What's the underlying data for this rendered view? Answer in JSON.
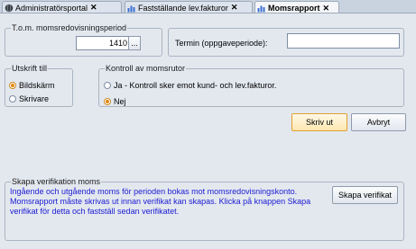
{
  "tabs": [
    {
      "label": "Administratörsportal",
      "icon": "globe-icon"
    },
    {
      "label": "Fastställande lev.fakturor",
      "icon": "report-icon"
    },
    {
      "label": "Momsrapport",
      "icon": "report-icon",
      "active": true
    }
  ],
  "period": {
    "legend": "T.o.m. momsredovisningsperiod",
    "value": "1410",
    "browse_label": "..."
  },
  "termin": {
    "label": "Termin (oppgaveperiode):",
    "value": ""
  },
  "output": {
    "legend": "Utskrift till",
    "options": [
      "Bildskärm",
      "Skrivare"
    ],
    "selected": "Bildskärm"
  },
  "control": {
    "legend": "Kontroll av momsrutor",
    "options": [
      "Ja - Kontroll sker emot kund- och lev.fakturor.",
      "Nej"
    ],
    "selected": "Nej"
  },
  "buttons": {
    "print": "Skriv ut",
    "cancel": "Avbryt"
  },
  "verification": {
    "legend": "Skapa verifikation moms",
    "info": "Ingående och utgående moms för perioden bokas mot momsredovisningskonto. Momsrapport måste skrivas ut innan verifikat kan skapas. Klicka på knappen Skapa verifikat för detta och fastställ sedan verifikatet.",
    "button": "Skapa verifikat"
  },
  "colors": {
    "accent": "#e08a10",
    "info_text": "#1a1ad0"
  }
}
